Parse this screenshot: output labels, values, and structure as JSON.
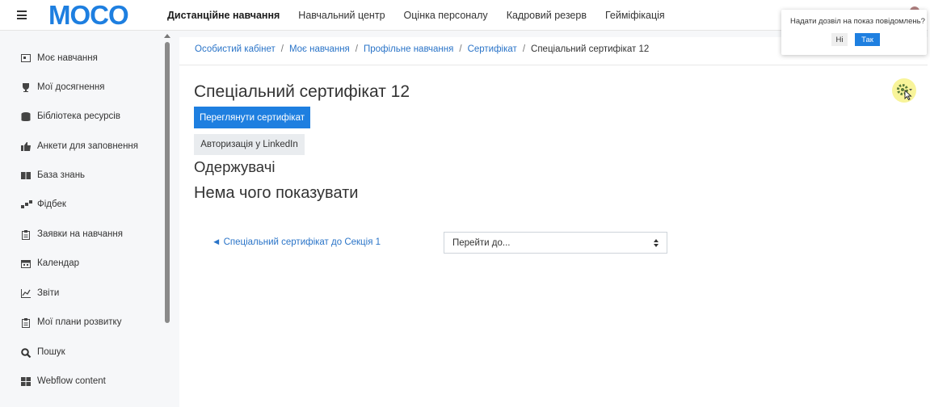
{
  "logo": {
    "text": "MOCO",
    "color": "#1e7fe0"
  },
  "nav": [
    {
      "label": "Дистанційне навчання",
      "active": true
    },
    {
      "label": "Навчальний центр"
    },
    {
      "label": "Оцінка персоналу"
    },
    {
      "label": "Кадровий резерв"
    },
    {
      "label": "Гейміфікація"
    }
  ],
  "notification": {
    "text": "Надати дозвіл на показ повідомлень?",
    "no_label": "Ні",
    "yes_label": "Так"
  },
  "sidebar": {
    "items": [
      {
        "label": "Моє навчання",
        "icon": "my-learning-icon"
      },
      {
        "label": "Мої досягнення",
        "icon": "trophy-icon"
      },
      {
        "label": "Бібліотека ресурсів",
        "icon": "database-icon"
      },
      {
        "label": "Анкети для заповнення",
        "icon": "thumbs-up-icon"
      },
      {
        "label": "База знань",
        "icon": "book-icon"
      },
      {
        "label": "Фідбек",
        "icon": "feedback-icon"
      },
      {
        "label": "Заявки на навчання",
        "icon": "clipboard-icon"
      },
      {
        "label": "Календар",
        "icon": "calendar-icon"
      },
      {
        "label": "Звіти",
        "icon": "chart-icon"
      },
      {
        "label": "Мої плани розвитку",
        "icon": "clipboard-icon"
      },
      {
        "label": "Пошук",
        "icon": "search-icon"
      },
      {
        "label": "Webflow content",
        "icon": "grid-icon"
      }
    ]
  },
  "breadcrumb": [
    "Особистий кабінет",
    "Моє навчання",
    "Профільне навчання",
    "Сертифікат",
    "Спеціальний сертифікат 12"
  ],
  "main": {
    "title": "Спеціальний сертифікат 12",
    "view_button": "Переглянути сертифікат",
    "linkedin_button": "Авторизація у LinkedIn",
    "recipients_heading": "Одержувачі",
    "empty_message": "Нема чого показувати",
    "prev_link": "◄ Спеціальний сертифікат до Секція 1",
    "jump_placeholder": "Перейти до..."
  },
  "colors": {
    "accent": "#1e7fe0",
    "link": "#2a74c8",
    "highlight": "#f6f078"
  }
}
